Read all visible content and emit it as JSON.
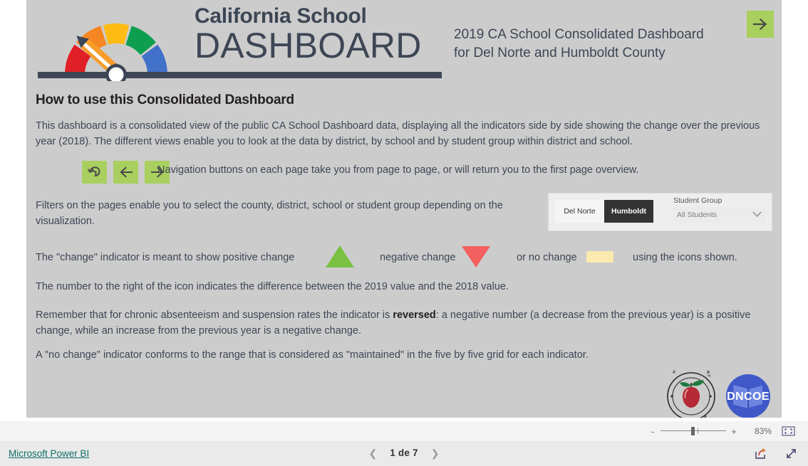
{
  "header": {
    "logo_line1": "California School",
    "logo_line2": "DASHBOARD",
    "logo_icon": "gauge-pencil-logo",
    "title_line1": "2019 CA School Consolidated Dashboard",
    "title_line2": "for Del Norte and Humboldt County",
    "next_button_icon": "arrow-right-icon",
    "accent_green": "#a9d05e",
    "text_color": "#3d4655"
  },
  "content": {
    "heading": "How to use this Consolidated Dashboard",
    "para_intro": "This dashboard is a consolidated view of the public CA School Dashboard data, displaying all the indicators side by side showing the change over the previous year (2018).   The different views enable you to look at the data by district, by school and by student group within district and school.",
    "para_nav": "Navigation buttons on each page take you from page to page, or will return you to the first page overview.",
    "para_filters": "Filters on the pages enable you to select the county, district, school or student group depending on the visualization.",
    "change_row": {
      "seg_a": "The \"change\" indicator is meant to show positive change",
      "seg_b": "negative change",
      "seg_c": "or no change",
      "seg_d": "using the icons shown.",
      "positive_color": "#7ac143",
      "negative_color": "#f4605f",
      "nochange_color": "#faeab0"
    },
    "para_number": "The number to the right of the icon indicates the difference between the 2019 value and the 2018 value.",
    "para_reversed_before": "Remember that for chronic absenteeism and suspension rates the indicator is ",
    "para_reversed_bold": "reversed",
    "para_reversed_after": ": a negative number (a decrease from the previous year) is a positive change, while an increase from the previous year is a negative change.",
    "para_nochange": "A \"no change\" indicator conforms to the range that is considered as \"maintained\" in the five by five grid for each indicator."
  },
  "nav_buttons": [
    {
      "name": "return-to-overview-button",
      "icon": "undo-arrow-icon"
    },
    {
      "name": "previous-page-button",
      "icon": "arrow-left-icon"
    },
    {
      "name": "next-page-button",
      "icon": "arrow-right-icon"
    }
  ],
  "filter_panel": {
    "county_toggle": [
      {
        "label": "Del Norte",
        "selected": false
      },
      {
        "label": "Humboldt",
        "selected": true
      }
    ],
    "student_group_label": "Student Group",
    "student_group_value": "All Students",
    "student_group_icon": "chevron-down-icon"
  },
  "logos": [
    {
      "name": "humboldt-county-office-of-education-logo",
      "text_top": "HUMBOLDT COUNTY",
      "text_bottom": "OFFICE OF EDUCATION"
    },
    {
      "name": "dncoe-logo",
      "text": "DNCOE"
    }
  ],
  "zoombar": {
    "minus": "-",
    "plus": "+",
    "percent": "83%",
    "fit_icon": "fit-to-page-icon"
  },
  "statusbar": {
    "powerbi_link": "Microsoft Power BI",
    "prev_icon": "chevron-left-icon",
    "next_icon": "chevron-right-icon",
    "page_label": "1 de 7",
    "share_icon": "share-icon",
    "fullscreen_icon": "fullscreen-icon"
  }
}
